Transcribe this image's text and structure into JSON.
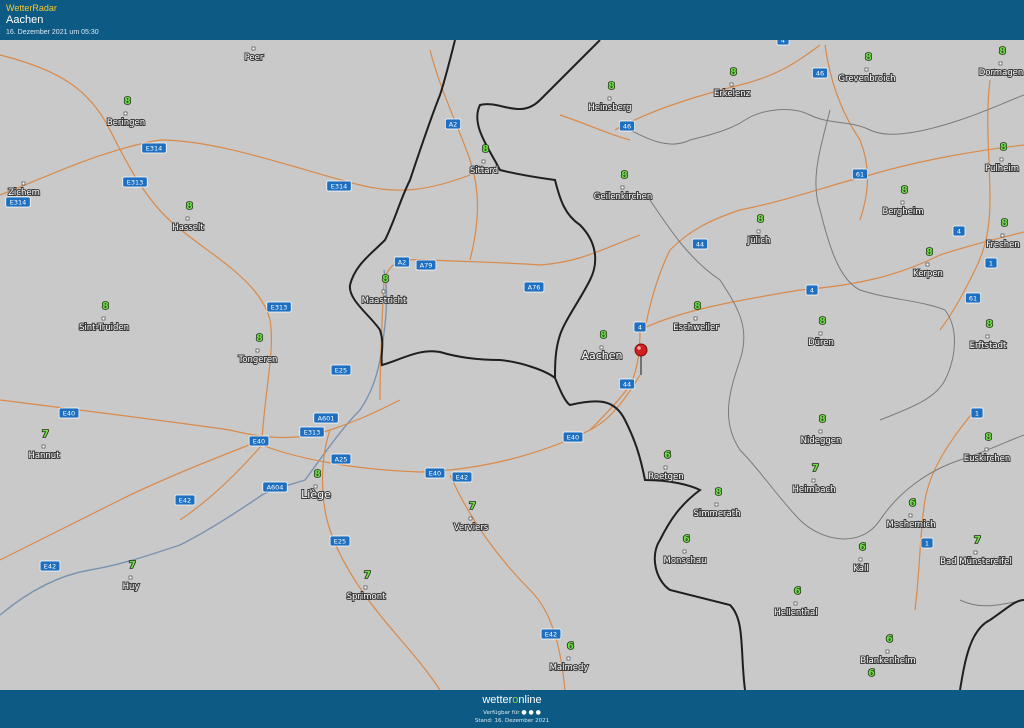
{
  "header": {
    "app_title": "WetterRadar",
    "location": "Aachen",
    "timestamp": "16. Dezember 2021 um 05:30"
  },
  "footer": {
    "logo_part1": "wetter",
    "logo_part2": "o",
    "logo_part3": "nline",
    "available": "Verfügbar für",
    "dots": "● ● ●",
    "stand": "Stand: 16. Dezember 2021"
  },
  "colors": {
    "header_bg": "#0d5b84",
    "map_bg": "#c9c9c9",
    "road": "#d98a4a",
    "border": "#1f1f1f",
    "river": "#7a93b0",
    "temp": "#6ee04a",
    "shield": "#1e6fc0"
  },
  "marker": {
    "icon": "red-map-pin-icon",
    "location": "Aachen"
  },
  "cities": [
    {
      "name": "Peer",
      "temp": ""
    },
    {
      "name": "Beringen",
      "temp": "8"
    },
    {
      "name": "Zichem",
      "temp": ""
    },
    {
      "name": "Hasselt",
      "temp": "8"
    },
    {
      "name": "Sint-Truiden",
      "temp": "8"
    },
    {
      "name": "Tongeren",
      "temp": "8"
    },
    {
      "name": "Hannut",
      "temp": "7"
    },
    {
      "name": "Liège",
      "temp": "8"
    },
    {
      "name": "Huy",
      "temp": "7"
    },
    {
      "name": "Sprimont",
      "temp": "7"
    },
    {
      "name": "Verviers",
      "temp": "7"
    },
    {
      "name": "Malmedy",
      "temp": "6"
    },
    {
      "name": "Maastricht",
      "temp": "8"
    },
    {
      "name": "Sittard",
      "temp": "8"
    },
    {
      "name": "Heinsberg",
      "temp": "8"
    },
    {
      "name": "Geilenkirchen",
      "temp": "8"
    },
    {
      "name": "Erkelenz",
      "temp": "8"
    },
    {
      "name": "Grevenbroich",
      "temp": "8"
    },
    {
      "name": "Dormagen",
      "temp": "8"
    },
    {
      "name": "Pulheim",
      "temp": "8"
    },
    {
      "name": "Bergheim",
      "temp": "8"
    },
    {
      "name": "Jülich",
      "temp": "8"
    },
    {
      "name": "Frechen",
      "temp": "8"
    },
    {
      "name": "Kerpen",
      "temp": "8"
    },
    {
      "name": "Erftstadt",
      "temp": "8"
    },
    {
      "name": "Aachen",
      "temp": "8"
    },
    {
      "name": "Eschweiler",
      "temp": "8"
    },
    {
      "name": "Düren",
      "temp": "8"
    },
    {
      "name": "Nideggen",
      "temp": "8"
    },
    {
      "name": "Euskirchen",
      "temp": "8"
    },
    {
      "name": "Roetgen",
      "temp": "6"
    },
    {
      "name": "Heimbach",
      "temp": "7"
    },
    {
      "name": "Simmerath",
      "temp": "8"
    },
    {
      "name": "Mechernich",
      "temp": "6"
    },
    {
      "name": "Monschau",
      "temp": "6"
    },
    {
      "name": "Kall",
      "temp": "6"
    },
    {
      "name": "Bad Münstereifel",
      "temp": "7"
    },
    {
      "name": "Hellenthal",
      "temp": "6"
    },
    {
      "name": "Blankenheim",
      "temp": "6"
    },
    {
      "name": "",
      "temp": "6"
    }
  ],
  "roads": [
    "A2",
    "A2",
    "A79",
    "A76",
    "46",
    "46",
    "61",
    "61",
    "44",
    "44",
    "4",
    "4",
    "4",
    "1",
    "1",
    "1",
    "E314",
    "E314",
    "E314",
    "E313",
    "E313",
    "E313",
    "E40",
    "E40",
    "E40",
    "E40",
    "E42",
    "E42",
    "E42",
    "E42",
    "E25",
    "E25",
    "A601",
    "A25",
    "A604",
    "4",
    "61"
  ]
}
